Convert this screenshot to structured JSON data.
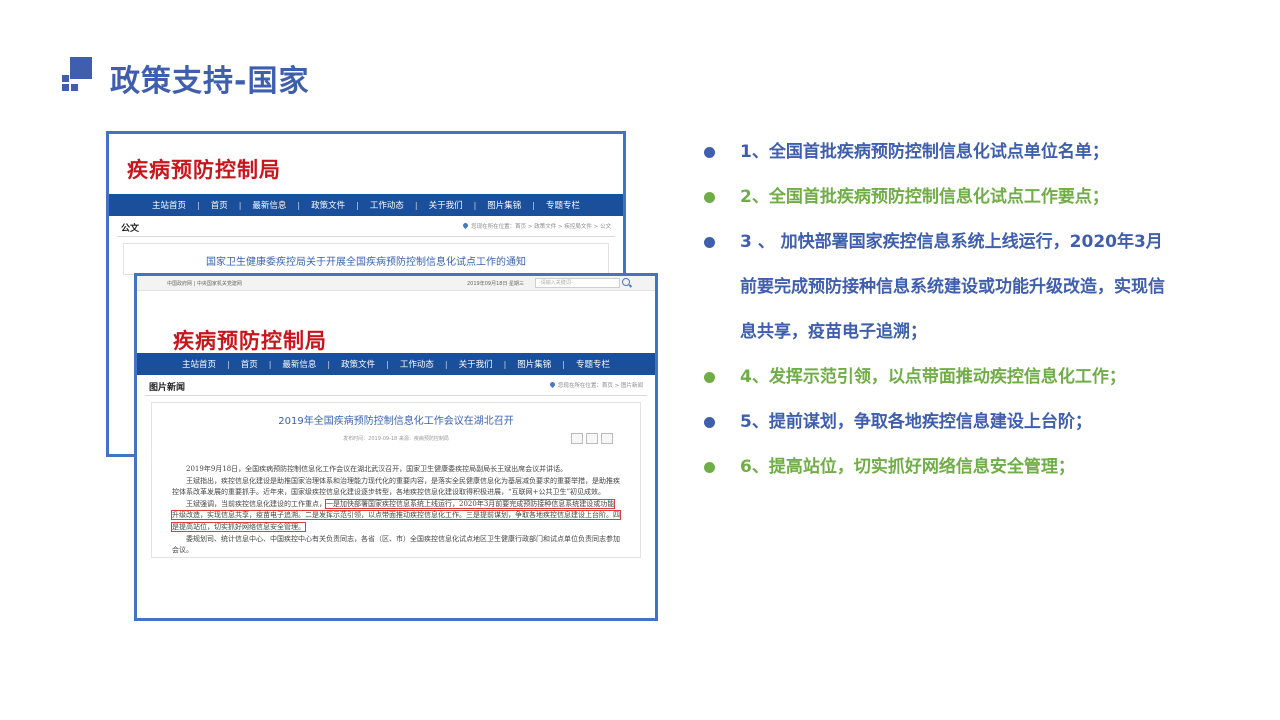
{
  "slide": {
    "title": "政策支持-国家"
  },
  "shot1": {
    "logo": "疾病预防控制局",
    "nav": [
      "主站首页",
      "首页",
      "最新信息",
      "政策文件",
      "工作动态",
      "关于我们",
      "图片集锦",
      "专题专栏"
    ],
    "section": "公文",
    "breadcrumb": "您现在所在位置：首页 > 政策文件 > 疾控局文件 > 公文",
    "doc_title": "国家卫生健康委疾控局关于开展全国疾病预防控制信息化试点工作的通知"
  },
  "shot2": {
    "topbar_left": "中国政府网 | 中央国家机关党建网",
    "topbar_date": "2019年09月18日 星期三",
    "search_placeholder": "-请输入关键词-",
    "logo": "疾病预防控制局",
    "nav": [
      "主站首页",
      "首页",
      "最新信息",
      "政策文件",
      "工作动态",
      "关于我们",
      "图片集锦",
      "专题专栏"
    ],
    "section": "图片新闻",
    "breadcrumb": "您现在所在位置：首页 > 图片新闻",
    "article_title": "2019年全国疾病预防控制信息化工作会议在湖北召开",
    "meta": "发布时间：2019-09-18  来源：疾病预防控制局",
    "para1": "2019年9月18日，全国疾病预防控制信息化工作会议在湖北武汉召开，国家卫生健康委疾控局副局长王斌出席会议并讲话。",
    "para2": "王斌指出，疾控信息化建设是助推国家治理体系和治理能力现代化的重要内容，是落实全民健康信息化为基层减负要求的重要举措，是助推疾控体系改革发展的重要抓手。近年来，国家级疾控信息化建设逐步转型，各地疾控信息化建设取得积极进展，“互联网+公共卫生”初见成效。",
    "para3_pre": "王斌强调，当前疾控信息化建设的工作重点，",
    "para3_hl1": "一是加快部署国家疾控信息系统上线运行，2020年3月前要完成预防接种信息系统建设或功能升级改造，实现信息共享，疫苗电子追溯。二是发挥示范引领，以点带面推动疾控信息化工作。三是提前谋划，争取各地疾控信息建设上台阶。四是提高站位，切实抓好网络信息安全管理。",
    "para4": "委规划司、统计信息中心、中国疾控中心有关负责同志，各省（区、市）全国疾控信息化试点地区卫生健康行政部门和试点单位负责同志参加会议。"
  },
  "bullets": [
    {
      "text": "1、全国首批疾病预防控制信息化试点单位名单；",
      "color": "#3f5fae"
    },
    {
      "text": "2、全国首批疾病预防控制信息化试点工作要点；",
      "color": "#70ad47"
    },
    {
      "text": "3 、 加快部署国家疾控信息系统上线运行，2020年3月前要完成预防接种信息系统建设或功能升级改造，实现信息共享，疫苗电子追溯；",
      "color": "#3f5fae"
    },
    {
      "text": "4、发挥示范引领，以点带面推动疾控信息化工作；",
      "color": "#70ad47"
    },
    {
      "text": "5、提前谋划，争取各地疾控信息建设上台阶；",
      "color": "#3f5fae"
    },
    {
      "text": "6、提高站位，切实抓好网络信息安全管理；",
      "color": "#70ad47"
    }
  ]
}
